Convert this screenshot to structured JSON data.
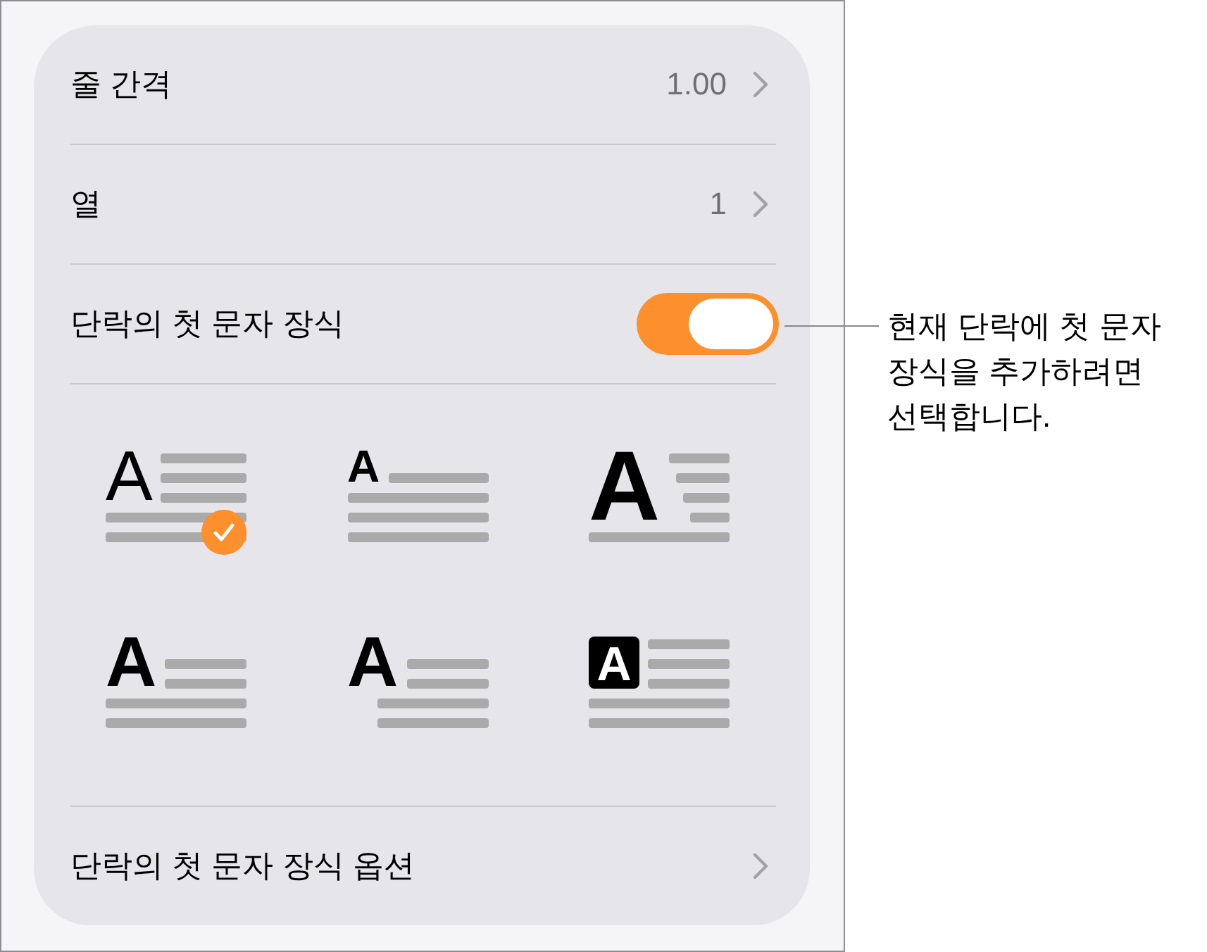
{
  "settings": [
    {
      "kind": "value",
      "label": "줄 간격",
      "value": "1.00"
    },
    {
      "kind": "value",
      "label": "열",
      "value": "1"
    },
    {
      "kind": "toggle",
      "label": "단락의 첫 문자 장식",
      "on": true
    }
  ],
  "drop_cap_styles": [
    {
      "kind": "regular",
      "letter": "A",
      "selected": true
    },
    {
      "kind": "small",
      "letter": "A",
      "selected": false
    },
    {
      "kind": "large",
      "letter": "A",
      "selected": false
    },
    {
      "kind": "bold",
      "letter": "A",
      "selected": false
    },
    {
      "kind": "indented",
      "letter": "A",
      "selected": false
    },
    {
      "kind": "boxed",
      "letter": "A",
      "selected": false
    }
  ],
  "options_row": {
    "label": "단락의 첫 문자 장식 옵션"
  },
  "callout": {
    "text": "현재 단락에 첫 문자 장식을 추가하려면 선택합니다."
  }
}
